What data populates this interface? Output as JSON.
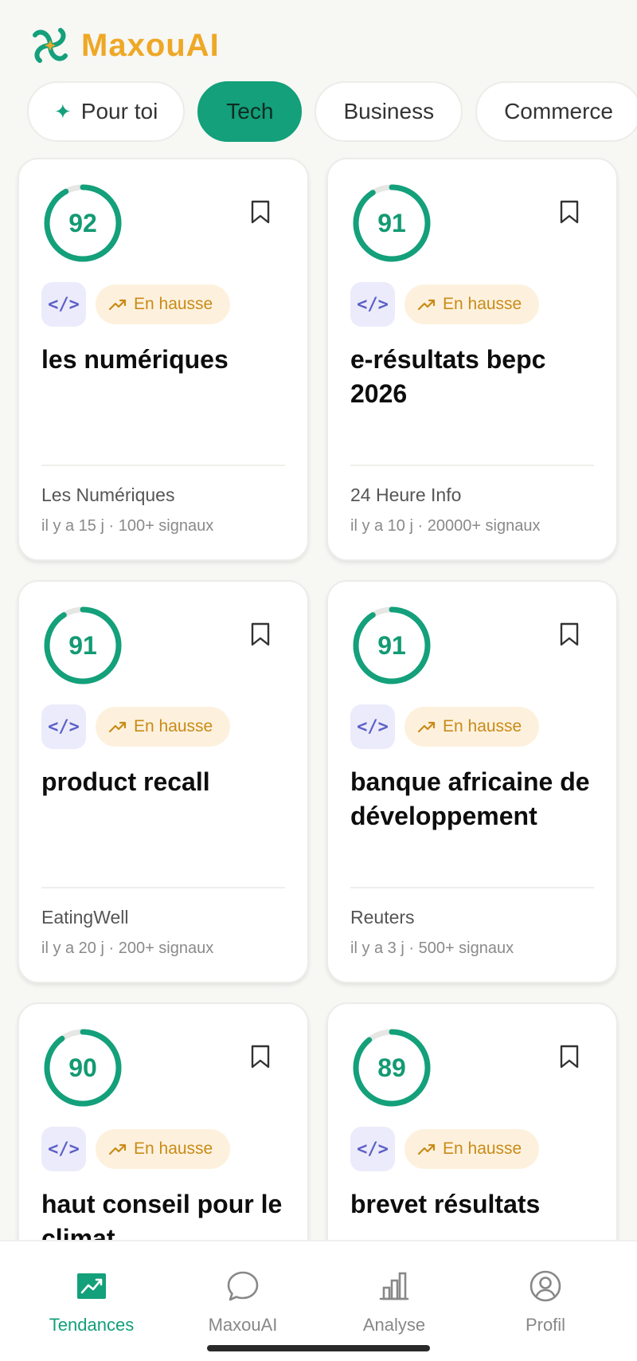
{
  "app": {
    "name": "MaxouAI",
    "accent": "#13a07a",
    "brand_color": "#eea826"
  },
  "tabs": [
    {
      "label": "Pour toi",
      "icon": "sparkle-icon",
      "active": false
    },
    {
      "label": "Tech",
      "active": true
    },
    {
      "label": "Business",
      "active": false
    },
    {
      "label": "Commerce",
      "active": false
    }
  ],
  "cards": [
    {
      "score": "92",
      "score_value": 92,
      "category_icon": "code-icon",
      "trend": "En hausse",
      "title": "les numériques",
      "source": "Les Numériques",
      "meta": "il y a 15 j · 100+ signaux"
    },
    {
      "score": "91",
      "score_value": 91,
      "category_icon": "code-icon",
      "trend": "En hausse",
      "title": "e-résultats bepc 2026",
      "source": "24 Heure Info",
      "meta": "il y a 10 j · 20000+ signaux"
    },
    {
      "score": "91",
      "score_value": 91,
      "category_icon": "code-icon",
      "trend": "En hausse",
      "title": "product recall",
      "source": "EatingWell",
      "meta": "il y a 20 j · 200+ signaux"
    },
    {
      "score": "91",
      "score_value": 91,
      "category_icon": "code-icon",
      "trend": "En hausse",
      "title": "banque africaine de développement",
      "source": "Reuters",
      "meta": "il y a 3 j · 500+ signaux"
    },
    {
      "score": "90",
      "score_value": 90,
      "category_icon": "code-icon",
      "trend": "En hausse",
      "title": "haut conseil pour le climat",
      "source": "",
      "meta": ""
    },
    {
      "score": "89",
      "score_value": 89,
      "category_icon": "code-icon",
      "trend": "En hausse",
      "title": "brevet résultats",
      "source": "",
      "meta": ""
    }
  ],
  "nav": [
    {
      "label": "Tendances",
      "icon": "trending-chart-icon",
      "active": true
    },
    {
      "label": "MaxouAI",
      "icon": "chat-bubble-icon",
      "active": false
    },
    {
      "label": "Analyse",
      "icon": "bar-chart-icon",
      "active": false
    },
    {
      "label": "Profil",
      "icon": "user-circle-icon",
      "active": false
    }
  ]
}
